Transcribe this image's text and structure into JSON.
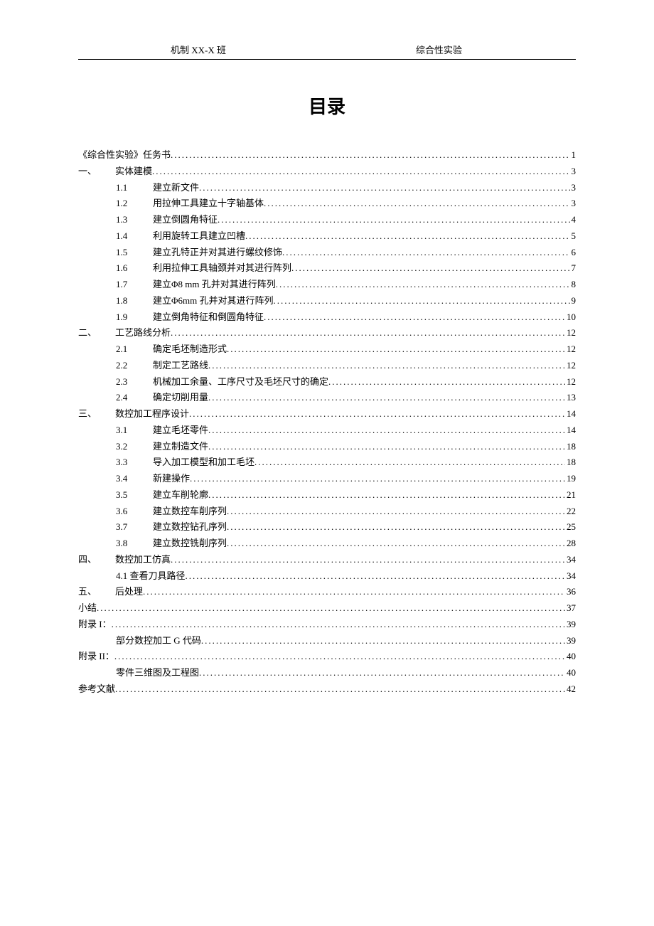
{
  "header": {
    "left": "机制 XX-X 班",
    "right": "综合性实验"
  },
  "title": "目录",
  "toc": [
    {
      "indent": 0,
      "num": "",
      "label": "《综合性实验》任务书",
      "page": "1"
    },
    {
      "indent": 0,
      "num": "一、",
      "label": "实体建模",
      "page": "3"
    },
    {
      "indent": 1,
      "num": "1.1",
      "label": "建立新文件",
      "page": "3"
    },
    {
      "indent": 1,
      "num": "1.2",
      "label": "用拉伸工具建立十字轴基体",
      "page": "3"
    },
    {
      "indent": 1,
      "num": "1.3",
      "label": "建立倒圆角特征",
      "page": "4"
    },
    {
      "indent": 1,
      "num": "1.4",
      "label": "利用旋转工具建立凹槽",
      "page": "5"
    },
    {
      "indent": 1,
      "num": "1.5",
      "label": "建立孔特正并对其进行螺纹修饰",
      "page": "6"
    },
    {
      "indent": 1,
      "num": "1.6",
      "label": "利用拉伸工具轴颈并对其进行阵列",
      "page": "7"
    },
    {
      "indent": 1,
      "num": "1.7",
      "label": "建立Φ8 mm 孔并对其进行阵列",
      "page": "8"
    },
    {
      "indent": 1,
      "num": "1.8",
      "label": "建立Φ6mm 孔并对其进行阵列",
      "page": "9"
    },
    {
      "indent": 1,
      "num": "1.9",
      "label": "建立倒角特征和倒圆角特征",
      "page": "10"
    },
    {
      "indent": 0,
      "num": "二、",
      "label": "工艺路线分析",
      "page": "12"
    },
    {
      "indent": 1,
      "num": "2.1",
      "label": "确定毛坯制造形式",
      "page": "12"
    },
    {
      "indent": 1,
      "num": "2.2",
      "label": "制定工艺路线",
      "page": "12"
    },
    {
      "indent": 1,
      "num": "2.3",
      "label": "机械加工余量、工序尺寸及毛坯尺寸的确定",
      "page": "12"
    },
    {
      "indent": 1,
      "num": "2.4",
      "label": "确定切削用量",
      "page": "13"
    },
    {
      "indent": 0,
      "num": "三、",
      "label": "数控加工程序设计",
      "page": "14"
    },
    {
      "indent": 1,
      "num": "3.1",
      "label": "建立毛坯零件",
      "page": "14"
    },
    {
      "indent": 1,
      "num": "3.2",
      "label": "建立制造文件",
      "page": "18"
    },
    {
      "indent": 1,
      "num": "3.3",
      "label": "导入加工模型和加工毛坯",
      "page": "18"
    },
    {
      "indent": 1,
      "num": "3.4",
      "label": "新建操作",
      "page": "19"
    },
    {
      "indent": 1,
      "num": "3.5",
      "label": "建立车削轮廓",
      "page": "21"
    },
    {
      "indent": 1,
      "num": "3.6",
      "label": "建立数控车削序列",
      "page": "22"
    },
    {
      "indent": 1,
      "num": "3.7",
      "label": "建立数控钻孔序列",
      "page": "25"
    },
    {
      "indent": 1,
      "num": "3.8",
      "label": "建立数控铣削序列",
      "page": "28"
    },
    {
      "indent": 0,
      "num": "四、",
      "label": "数控加工仿真",
      "page": "34"
    },
    {
      "indent": 1,
      "num": "",
      "label": "4.1 查看刀具路径",
      "page": "34"
    },
    {
      "indent": 0,
      "num": "五、",
      "label": "后处理",
      "page": "36"
    },
    {
      "indent": 0,
      "num": "",
      "label": "小结",
      "page": "37"
    },
    {
      "indent": 0,
      "num": "",
      "label": "附录 I：",
      "page": "39"
    },
    {
      "indent": 1,
      "num": "",
      "label": "部分数控加工 G 代码",
      "page": "39"
    },
    {
      "indent": 0,
      "num": "",
      "label": "附录 II：",
      "page": "40"
    },
    {
      "indent": 1,
      "num": "",
      "label": "零件三维图及工程图",
      "page": "40"
    },
    {
      "indent": 0,
      "num": "",
      "label": "参考文献",
      "page": "42"
    }
  ]
}
